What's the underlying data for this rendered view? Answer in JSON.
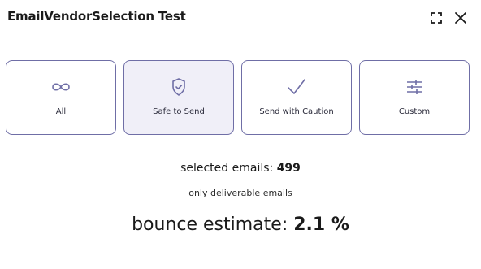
{
  "header": {
    "title": "EmailVendorSelection Test",
    "expand_icon": "expand-icon",
    "close_icon": "close-icon"
  },
  "options": [
    {
      "label": "All",
      "icon": "infinity-icon",
      "selected": false
    },
    {
      "label": "Safe to Send",
      "icon": "shield-check-icon",
      "selected": true
    },
    {
      "label": "Send with Caution",
      "icon": "checkmark-icon",
      "selected": false
    },
    {
      "label": "Custom",
      "icon": "sliders-icon",
      "selected": false
    }
  ],
  "stats": {
    "selected_label": "selected emails: ",
    "selected_value": "499",
    "deliverable_note": "only deliverable emails",
    "bounce_label": "bounce estimate: ",
    "bounce_value": "2.1 %"
  },
  "colors": {
    "accent": "#6f6ea6",
    "selected_bg": "#f0eff8",
    "text": "#1a1a1a"
  }
}
